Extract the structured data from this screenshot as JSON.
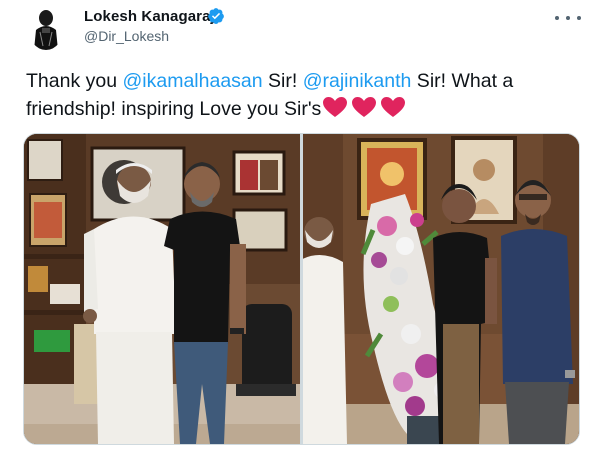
{
  "author": {
    "display_name": "Lokesh Kanagaraj",
    "handle": "@Dir_Lokesh",
    "verified": true,
    "avatar_icon": "profile-avatar"
  },
  "menu": {
    "icon": "more-horizontal-icon"
  },
  "tweet": {
    "segments": [
      {
        "text": "Thank you ",
        "type": "plain"
      },
      {
        "text": "@ikamalhaasan",
        "type": "mention"
      },
      {
        "text": " Sir! ",
        "type": "plain"
      },
      {
        "text": "@rajinikanth",
        "type": "mention"
      },
      {
        "text": " Sir! What a friendship! inspiring Love you Sir's",
        "type": "plain"
      }
    ],
    "emoji": [
      "❤️",
      "❤️",
      "❤️"
    ]
  },
  "media": {
    "count": 2,
    "images": [
      {
        "icon": "photo-two-men-office"
      },
      {
        "icon": "photo-bouquet-presentation"
      }
    ]
  },
  "colors": {
    "mention": "#1d9bf0",
    "verified_badge": "#1d9bf0",
    "heart": "#e0245e",
    "secondary_text": "#536471"
  }
}
